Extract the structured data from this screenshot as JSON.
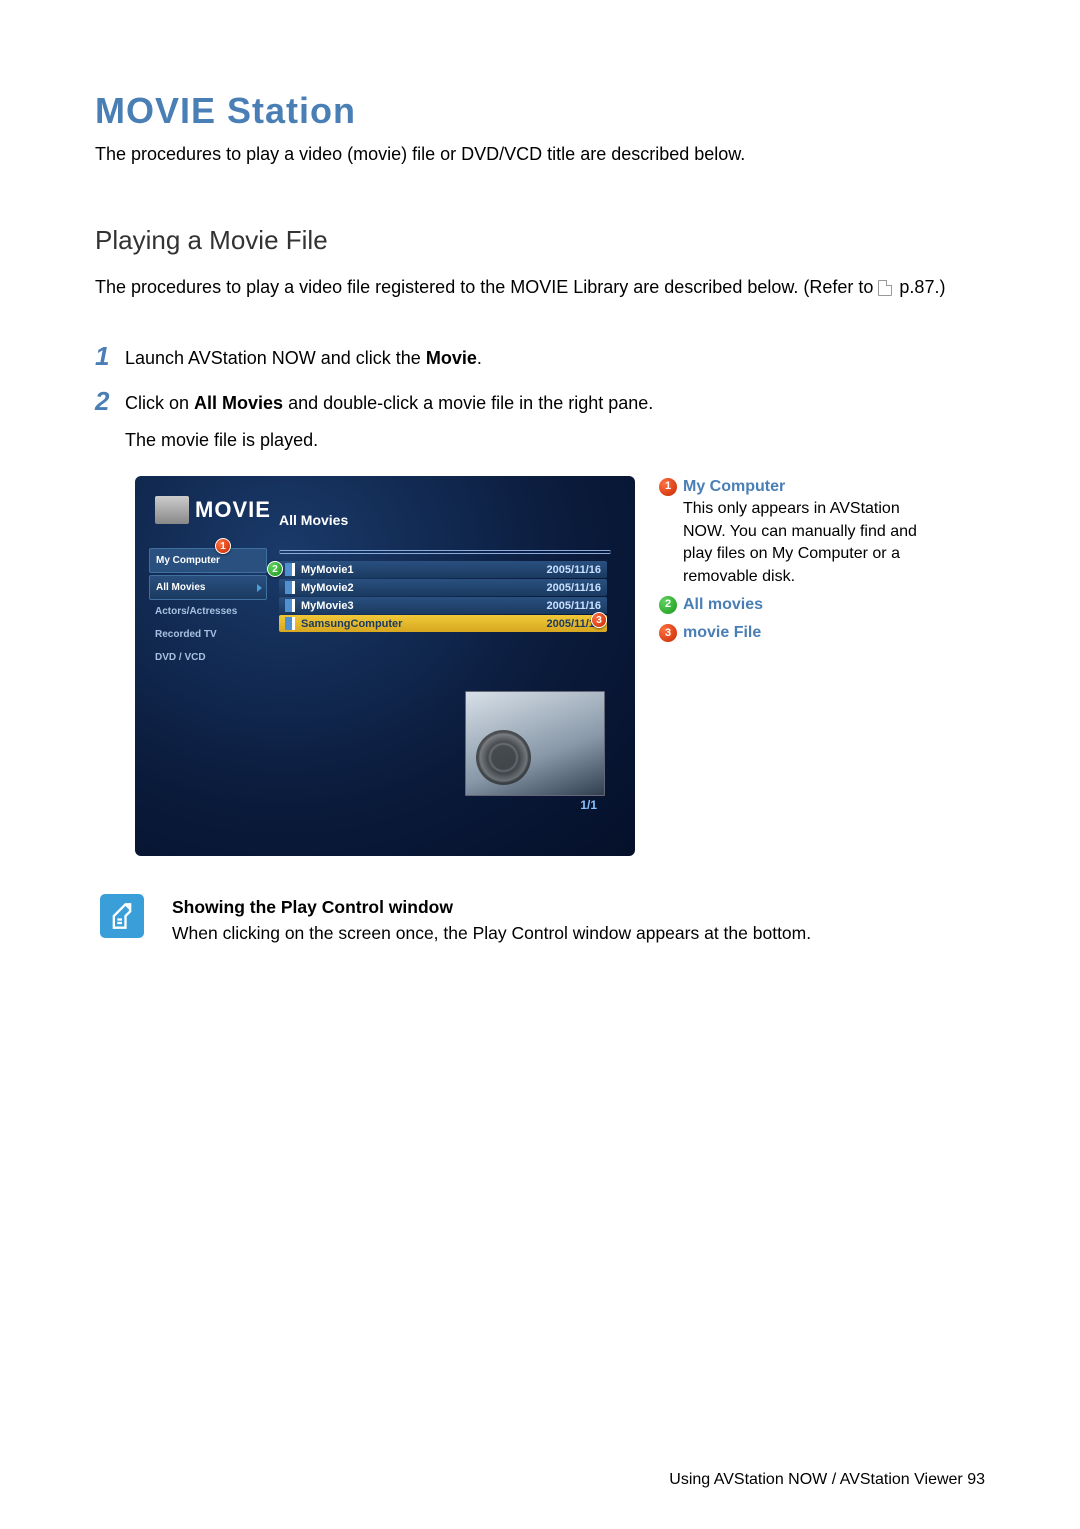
{
  "title": "MOVIE Station",
  "intro": "The procedures to play a video (movie) file or DVD/VCD title are described below.",
  "section_heading": "Playing a Movie File",
  "section_intro_1": "The procedures to play a video file registered to the MOVIE Library are described below. (Refer to ",
  "section_intro_ref": "p.87.)",
  "steps": {
    "s1_num": "1",
    "s1_a": "Launch AVStation NOW and click the ",
    "s1_b": "Movie",
    "s1_c": ".",
    "s2_num": "2",
    "s2_a": "Click on ",
    "s2_b": "All Movies",
    "s2_c": " and double-click a movie file in the right pane.",
    "s2_d": "The movie file is played."
  },
  "screenshot": {
    "logo": "MOVIE",
    "pane_title": "All Movies",
    "sidebar": {
      "my_computer": "My Computer",
      "all_movies": "All Movies",
      "actors": "Actors/Actresses",
      "recorded_tv": "Recorded TV",
      "dvd_vcd": "DVD / VCD"
    },
    "rows": [
      {
        "name": "MyMovie1",
        "date": "2005/11/16"
      },
      {
        "name": "MyMovie2",
        "date": "2005/11/16"
      },
      {
        "name": "MyMovie3",
        "date": "2005/11/16"
      },
      {
        "name": "SamsungComputer",
        "date": "2005/11/16"
      }
    ],
    "pagenum": "1/1",
    "badges": {
      "b1": "1",
      "b2": "2",
      "b3": "3"
    }
  },
  "legend": {
    "l1_title": "My Computer",
    "l1_desc": "This only appears in AVStation NOW. You can manually find and play files on My Computer or a removable disk.",
    "l2_title": "All movies",
    "l3_title": "movie File",
    "n1": "1",
    "n2": "2",
    "n3": "3"
  },
  "note": {
    "title": "Showing the Play Control window",
    "body": "When clicking on the screen once, the Play Control window appears at the bottom."
  },
  "footer": "Using AVStation NOW / AVStation Viewer   93"
}
